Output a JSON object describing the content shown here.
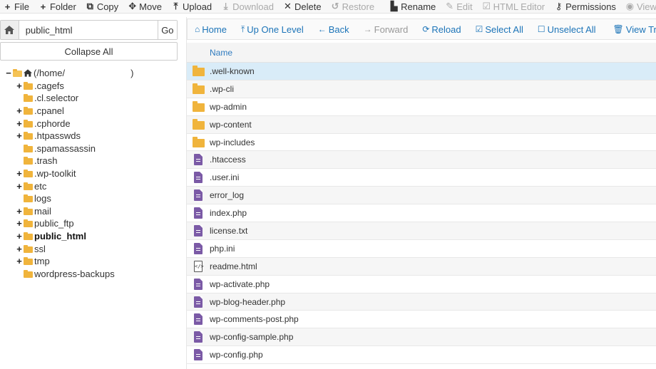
{
  "toolbar": {
    "items": [
      {
        "label": "File",
        "glyph": "+",
        "disabled": false
      },
      {
        "label": "Folder",
        "glyph": "+",
        "disabled": false
      },
      {
        "label": "Copy",
        "glyph": "⧉",
        "disabled": false
      },
      {
        "label": "Move",
        "glyph": "✥",
        "disabled": false
      },
      {
        "label": "Upload",
        "glyph": "⤒",
        "disabled": false
      },
      {
        "label": "Download",
        "glyph": "⤓",
        "disabled": true
      },
      {
        "label": "Delete",
        "glyph": "✕",
        "disabled": false
      },
      {
        "label": "Restore",
        "glyph": "↺",
        "disabled": true
      },
      {
        "label": "Rename",
        "glyph": "▙",
        "disabled": false
      },
      {
        "label": "Edit",
        "glyph": "✎",
        "disabled": true
      },
      {
        "label": "HTML Editor",
        "glyph": "☑",
        "disabled": true
      },
      {
        "label": "Permissions",
        "glyph": "⚷",
        "disabled": false
      },
      {
        "label": "View",
        "glyph": "◉",
        "disabled": true
      }
    ]
  },
  "path": {
    "value": "public_html",
    "go_label": "Go"
  },
  "collapse_label": "Collapse All",
  "tree": {
    "root_label": "(/home/",
    "root_close": ")",
    "items": [
      {
        "label": ".cagefs",
        "expandable": true,
        "bold": false
      },
      {
        "label": ".cl.selector",
        "expandable": false,
        "bold": false
      },
      {
        "label": ".cpanel",
        "expandable": true,
        "bold": false
      },
      {
        "label": ".cphorde",
        "expandable": true,
        "bold": false
      },
      {
        "label": ".htpasswds",
        "expandable": true,
        "bold": false
      },
      {
        "label": ".spamassassin",
        "expandable": false,
        "bold": false
      },
      {
        "label": ".trash",
        "expandable": false,
        "bold": false
      },
      {
        "label": ".wp-toolkit",
        "expandable": true,
        "bold": false
      },
      {
        "label": "etc",
        "expandable": true,
        "bold": false
      },
      {
        "label": "logs",
        "expandable": false,
        "bold": false
      },
      {
        "label": "mail",
        "expandable": true,
        "bold": false
      },
      {
        "label": "public_ftp",
        "expandable": true,
        "bold": false
      },
      {
        "label": "public_html",
        "expandable": true,
        "bold": true
      },
      {
        "label": "ssl",
        "expandable": true,
        "bold": false
      },
      {
        "label": "tmp",
        "expandable": true,
        "bold": false
      },
      {
        "label": "wordpress-backups",
        "expandable": false,
        "bold": false
      }
    ]
  },
  "nav": {
    "items": [
      {
        "label": "Home",
        "glyph": "⌂",
        "disabled": false
      },
      {
        "label": "Up One Level",
        "glyph": "⤒",
        "disabled": false
      },
      {
        "label": "Back",
        "glyph": "←",
        "disabled": false
      },
      {
        "label": "Forward",
        "glyph": "→",
        "disabled": true
      },
      {
        "label": "Reload",
        "glyph": "⟳",
        "disabled": false
      },
      {
        "label": "Select All",
        "glyph": "☑",
        "disabled": false
      },
      {
        "label": "Unselect All",
        "glyph": "☐",
        "disabled": false
      },
      {
        "label": "View Trash",
        "glyph": "🗑",
        "disabled": false
      },
      {
        "label": "",
        "glyph": "🗑",
        "disabled": false
      }
    ]
  },
  "list": {
    "column_name": "Name",
    "rows": [
      {
        "name": ".well-known",
        "type": "folder",
        "selected": true
      },
      {
        "name": ".wp-cli",
        "type": "folder",
        "selected": false
      },
      {
        "name": "wp-admin",
        "type": "folder",
        "selected": false
      },
      {
        "name": "wp-content",
        "type": "folder",
        "selected": false
      },
      {
        "name": "wp-includes",
        "type": "folder",
        "selected": false
      },
      {
        "name": ".htaccess",
        "type": "doc",
        "selected": false
      },
      {
        "name": ".user.ini",
        "type": "doc",
        "selected": false
      },
      {
        "name": "error_log",
        "type": "doc",
        "selected": false
      },
      {
        "name": "index.php",
        "type": "doc",
        "selected": false
      },
      {
        "name": "license.txt",
        "type": "doc",
        "selected": false
      },
      {
        "name": "php.ini",
        "type": "doc",
        "selected": false
      },
      {
        "name": "readme.html",
        "type": "html",
        "selected": false
      },
      {
        "name": "wp-activate.php",
        "type": "doc",
        "selected": false
      },
      {
        "name": "wp-blog-header.php",
        "type": "doc",
        "selected": false
      },
      {
        "name": "wp-comments-post.php",
        "type": "doc",
        "selected": false
      },
      {
        "name": "wp-config-sample.php",
        "type": "doc",
        "selected": false
      },
      {
        "name": "wp-config.php",
        "type": "doc",
        "selected": false
      }
    ]
  }
}
